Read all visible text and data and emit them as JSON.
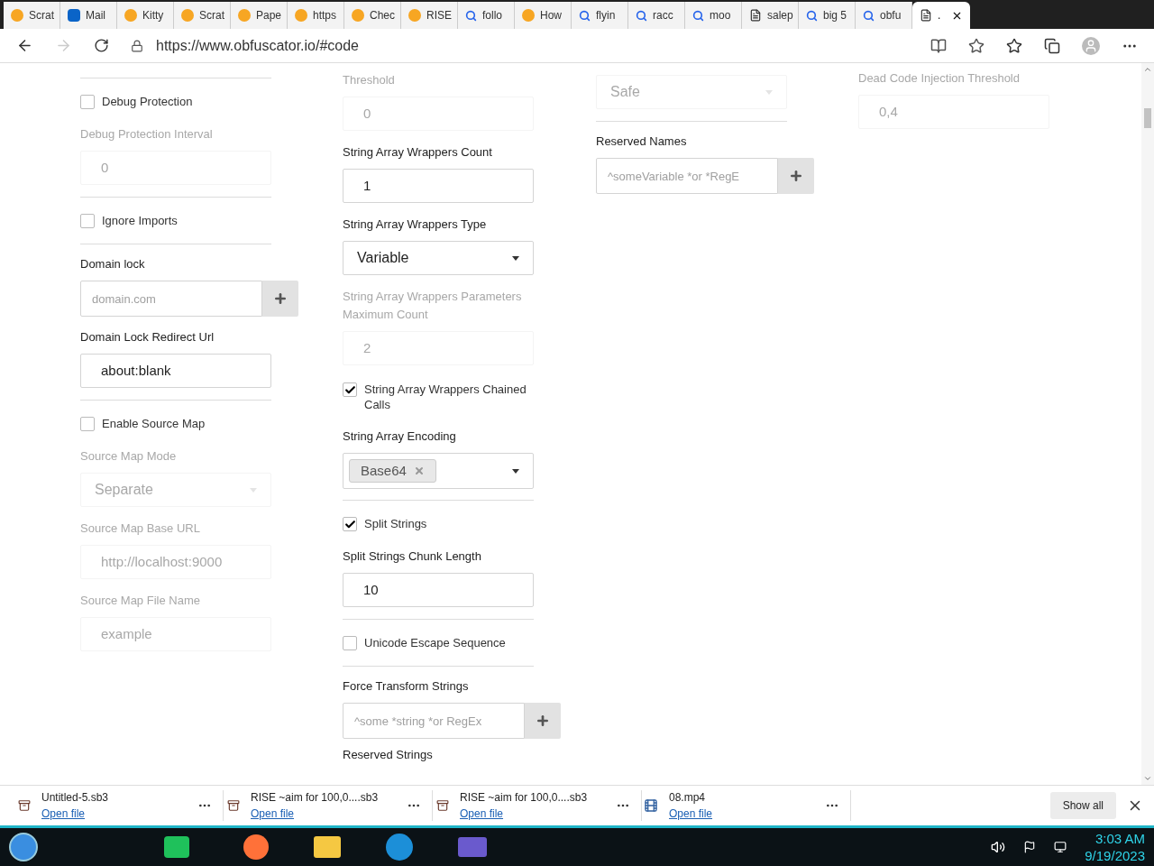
{
  "tabs": [
    {
      "label": "Scrat",
      "kind": "scratch",
      "selected": false
    },
    {
      "label": "Mail",
      "kind": "outlook",
      "selected": false
    },
    {
      "label": "Kitty",
      "kind": "scratch",
      "selected": false
    },
    {
      "label": "Scrat",
      "kind": "scratch",
      "selected": false
    },
    {
      "label": "Pape",
      "kind": "scratch",
      "selected": false
    },
    {
      "label": "https",
      "kind": "scratch",
      "selected": false
    },
    {
      "label": "Chec",
      "kind": "scratch",
      "selected": false
    },
    {
      "label": "RISE",
      "kind": "scratch",
      "selected": false
    },
    {
      "label": "follo",
      "kind": "search",
      "selected": false
    },
    {
      "label": "How",
      "kind": "scratch",
      "selected": false
    },
    {
      "label": "flyin",
      "kind": "search",
      "selected": false
    },
    {
      "label": "racc",
      "kind": "search",
      "selected": false
    },
    {
      "label": "moo",
      "kind": "search",
      "selected": false
    },
    {
      "label": "salep",
      "kind": "page",
      "selected": false
    },
    {
      "label": "big 5",
      "kind": "search",
      "selected": false
    },
    {
      "label": "obfu",
      "kind": "search",
      "selected": false
    },
    {
      "label": ".",
      "kind": "page",
      "selected": true
    }
  ],
  "address": {
    "url": "https://www.obfuscator.io/#code"
  },
  "columns": [
    [
      {
        "kind": "divider"
      },
      {
        "kind": "checkbox",
        "label": "Debug Protection",
        "checked": false
      },
      {
        "kind": "input",
        "label": "Debug Protection Interval",
        "value": "0",
        "disabled": true
      },
      {
        "kind": "divider"
      },
      {
        "kind": "checkbox",
        "label": "Ignore Imports",
        "checked": false
      },
      {
        "kind": "divider"
      },
      {
        "kind": "add",
        "label": "Domain lock",
        "placeholder": "domain.com"
      },
      {
        "kind": "input",
        "label": "Domain Lock Redirect Url",
        "value": "about:blank",
        "disabled": false
      },
      {
        "kind": "divider"
      },
      {
        "kind": "checkbox",
        "label": "Enable Source Map",
        "checked": false
      },
      {
        "kind": "select",
        "label": "Source Map Mode",
        "value": "Separate",
        "disabled": true
      },
      {
        "kind": "input",
        "label": "Source Map Base URL",
        "value": "http://localhost:9000",
        "disabled": true
      },
      {
        "kind": "input",
        "label": "Source Map File Name",
        "value": "example",
        "disabled": true
      }
    ],
    [
      {
        "kind": "input",
        "label": "Threshold",
        "value": "0",
        "disabled": true
      },
      {
        "kind": "input",
        "label": "String Array Wrappers Count",
        "value": "1",
        "disabled": false
      },
      {
        "kind": "select",
        "label": "String Array Wrappers Type",
        "value": "Variable",
        "disabled": false
      },
      {
        "kind": "input",
        "label": "String Array Wrappers Parameters Maximum Count",
        "value": "2",
        "disabled": true
      },
      {
        "kind": "checkbox",
        "label": "String Array Wrappers Chained Calls",
        "checked": true
      },
      {
        "kind": "tags",
        "label": "String Array Encoding",
        "tags": [
          "Base64"
        ]
      },
      {
        "kind": "divider"
      },
      {
        "kind": "checkbox",
        "label": "Split Strings",
        "checked": true
      },
      {
        "kind": "input",
        "label": "Split Strings Chunk Length",
        "value": "10",
        "disabled": false
      },
      {
        "kind": "divider"
      },
      {
        "kind": "checkbox",
        "label": "Unicode Escape Sequence",
        "checked": false
      },
      {
        "kind": "divider"
      },
      {
        "kind": "add",
        "label": "Force Transform Strings",
        "placeholder": "^some *string *or RegEx"
      },
      {
        "kind": "heading",
        "label": "Reserved Strings"
      }
    ],
    [
      {
        "kind": "select",
        "value": "Safe",
        "disabled": true
      },
      {
        "kind": "divider"
      },
      {
        "kind": "add",
        "label": "Reserved Names",
        "placeholder": "^someVariable *or *RegE"
      }
    ],
    [
      {
        "kind": "input",
        "label": "Dead Code Injection Threshold",
        "value": "0,4",
        "disabled": true
      }
    ]
  ],
  "downloads": [
    {
      "name": "Untitled-5.sb3",
      "link": "Open file",
      "kind": "archive"
    },
    {
      "name": "RISE ~aim for 100,0....sb3",
      "link": "Open file",
      "kind": "archive"
    },
    {
      "name": "RISE ~aim for 100,0....sb3",
      "link": "Open file",
      "kind": "archive"
    },
    {
      "name": "08.mp4",
      "link": "Open file",
      "kind": "video"
    }
  ],
  "show_all": "Show all",
  "clock": {
    "time": "3:03 AM",
    "date": "9/19/2023"
  }
}
